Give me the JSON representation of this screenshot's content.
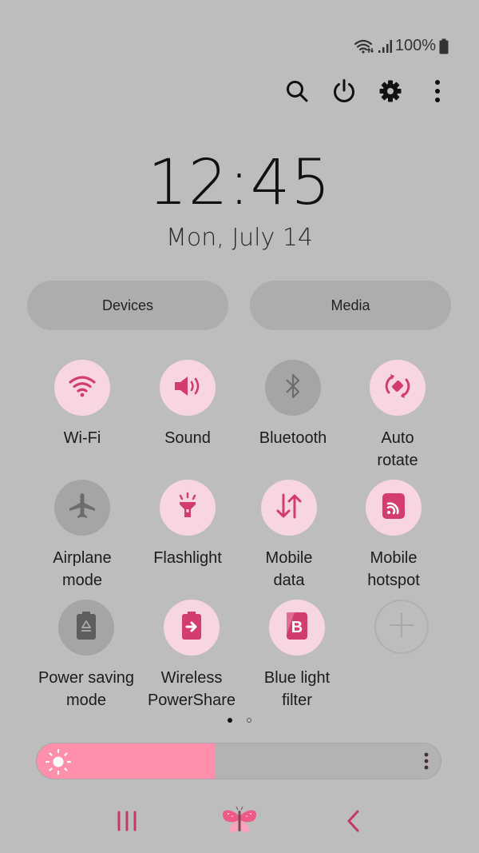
{
  "status_bar": {
    "wifi_icon": "wifi-icon",
    "signal_icon": "signal-icon",
    "battery_percent": "100%",
    "battery_icon": "battery-full-icon"
  },
  "top_actions": [
    {
      "name": "search",
      "icon": "search-icon"
    },
    {
      "name": "power",
      "icon": "power-icon"
    },
    {
      "name": "settings",
      "icon": "gear-icon"
    },
    {
      "name": "more",
      "icon": "more-vertical-icon"
    }
  ],
  "clock": {
    "time": "12:45",
    "date": "Mon, July 14"
  },
  "pills": {
    "devices": "Devices",
    "media": "Media"
  },
  "tiles": [
    {
      "label": "Wi-Fi",
      "state": "on",
      "icon": "wifi-icon"
    },
    {
      "label": "Sound",
      "state": "on",
      "icon": "sound-icon"
    },
    {
      "label": "Bluetooth",
      "state": "off",
      "icon": "bluetooth-icon"
    },
    {
      "label": "Auto\nrotate",
      "state": "on",
      "icon": "auto-rotate-icon"
    },
    {
      "label": "Airplane\nmode",
      "state": "off",
      "icon": "airplane-icon"
    },
    {
      "label": "Flashlight",
      "state": "on",
      "icon": "flashlight-icon"
    },
    {
      "label": "Mobile\ndata",
      "state": "on",
      "icon": "mobile-data-icon"
    },
    {
      "label": "Mobile\nhotspot",
      "state": "on",
      "icon": "hotspot-icon"
    },
    {
      "label": "Power saving\nmode",
      "state": "off",
      "icon": "power-saving-icon"
    },
    {
      "label": "Wireless\nPowerShare",
      "state": "on",
      "icon": "wireless-powershare-icon"
    },
    {
      "label": "Blue light\nfilter",
      "state": "on",
      "icon": "blue-light-filter-icon"
    },
    {
      "label": "",
      "state": "add",
      "icon": "add-icon"
    }
  ],
  "page_indicator": {
    "current": 1,
    "total": 2
  },
  "brightness": {
    "level_percent": 44,
    "icon": "sun-icon",
    "menu_icon": "more-vertical-icon"
  },
  "colors": {
    "accent": "#d23c6e",
    "tile_on_bg": "#f7d6e0",
    "tile_off_bg": "#a5a5a5",
    "background": "#bdbdbd",
    "brightness_fill": "#ff8fab"
  },
  "nav_bar": {
    "recents": "recents-icon",
    "home": "butterfly-home-icon",
    "back": "back-icon"
  }
}
